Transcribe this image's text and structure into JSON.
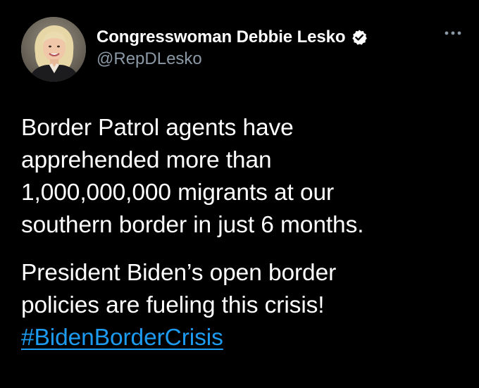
{
  "tweet": {
    "author": {
      "display_name": "Congresswoman Debbie Lesko",
      "handle": "@RepDLesko",
      "verified": true,
      "avatar_icon": "profile-photo"
    },
    "more_icon": "ellipsis-icon",
    "body": {
      "paragraph_1": [
        "Border Patrol agents have",
        "apprehended more than",
        "1,000,000,000 migrants at our",
        "southern border in just 6 months."
      ],
      "paragraph_2": [
        "President Biden’s open border",
        "policies are fueling this crisis!"
      ],
      "hashtag": "#BidenBorderCrisis"
    }
  },
  "colors": {
    "background": "#000000",
    "text": "#ffffff",
    "secondary_text": "#8b98a5",
    "link": "#1d9bf0"
  }
}
